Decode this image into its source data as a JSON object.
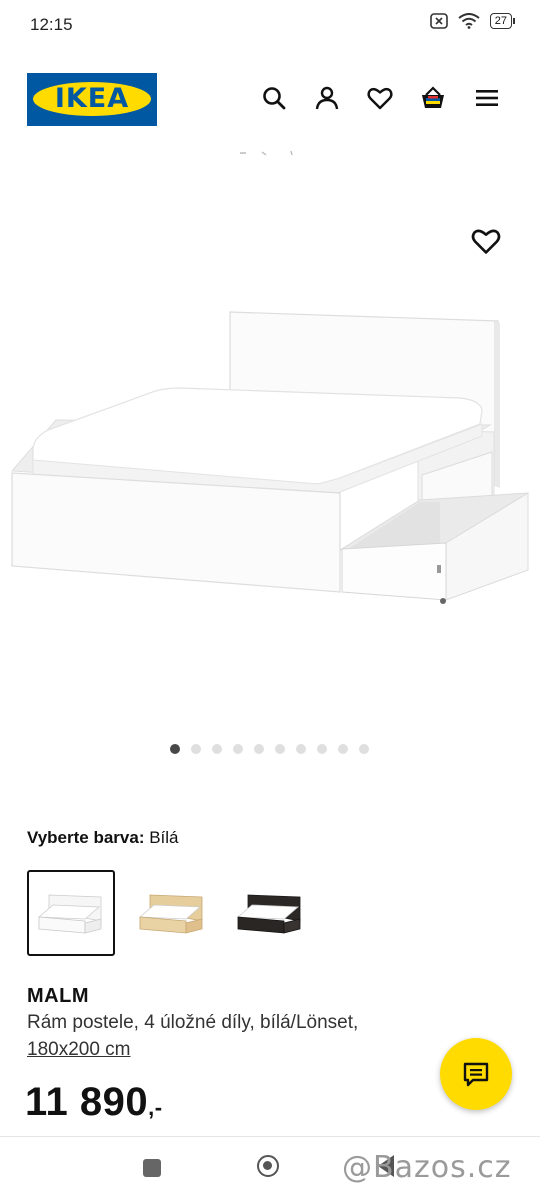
{
  "status_bar": {
    "time": "12:15",
    "battery": "27"
  },
  "header": {
    "logo_text": "IKEA",
    "icons": [
      "search-icon",
      "account-icon",
      "heart-icon",
      "basket-icon",
      "menu-icon"
    ]
  },
  "gallery": {
    "image_count": 10,
    "active_index": 0
  },
  "color_selector": {
    "label": "Vyberte barva:",
    "selected": "Bílá",
    "options": [
      {
        "name": "white",
        "color": "#ffffff"
      },
      {
        "name": "oak-veneer",
        "color": "#e3c99a"
      },
      {
        "name": "black-brown",
        "color": "#2a2624"
      }
    ]
  },
  "product": {
    "name": "MALM",
    "description": "Rám postele, 4 úložné díly, bílá/Lönset,",
    "size": "180x200 cm",
    "price_main": "11 890",
    "price_suffix": ",-"
  },
  "watermark": "@Bazos.cz",
  "colors": {
    "ikea_blue": "#0058a3",
    "ikea_yellow": "#ffdb00"
  }
}
